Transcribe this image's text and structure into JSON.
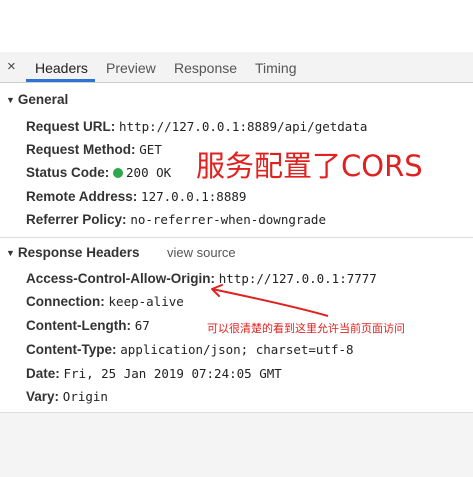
{
  "tabs": {
    "close_label": "×",
    "items": [
      {
        "label": "Headers"
      },
      {
        "label": "Preview"
      },
      {
        "label": "Response"
      },
      {
        "label": "Timing"
      }
    ],
    "active": "Headers"
  },
  "general": {
    "title": "General",
    "rows": [
      {
        "key": "Request URL:",
        "value": "http://127.0.0.1:8889/api/getdata"
      },
      {
        "key": "Request Method:",
        "value": "GET"
      },
      {
        "key": "Status Code:",
        "value": "200 OK"
      },
      {
        "key": "Remote Address:",
        "value": "127.0.0.1:8889"
      },
      {
        "key": "Referrer Policy:",
        "value": "no-referrer-when-downgrade"
      }
    ]
  },
  "response_headers": {
    "title": "Response Headers",
    "view_source": "view source",
    "rows": [
      {
        "key": "Access-Control-Allow-Origin:",
        "value": "http://127.0.0.1:7777"
      },
      {
        "key": "Connection:",
        "value": "keep-alive"
      },
      {
        "key": "Content-Length:",
        "value": "67"
      },
      {
        "key": "Content-Type:",
        "value": "application/json; charset=utf-8"
      },
      {
        "key": "Date:",
        "value": "Fri, 25 Jan 2019 07:24:05 GMT"
      },
      {
        "key": "Vary:",
        "value": "Origin"
      }
    ]
  },
  "annotations": {
    "main": "服务配置了CORS",
    "note": "可以很清楚的看到这里允许当前页面访问"
  },
  "colors": {
    "accent": "#2b74d6",
    "status_ok": "#2aa84a",
    "annotation": "#e0211f"
  }
}
